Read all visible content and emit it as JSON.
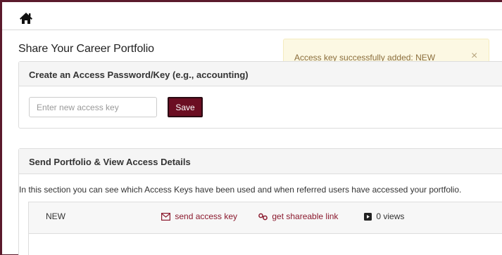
{
  "topbar": {
    "home_icon": "home-icon"
  },
  "page": {
    "title": "Share Your Career Portfolio"
  },
  "alert": {
    "message": "Access key successfully added: NEW",
    "close_label": "×",
    "background_color": "#fcf8e3",
    "text_color": "#8a6d3b"
  },
  "create_panel": {
    "title": "Create an Access Password/Key (e.g., accounting)",
    "input_placeholder": "Enter new access key",
    "input_value": "",
    "save_label": "Save",
    "save_color": "#6b0e22"
  },
  "send_panel": {
    "title": "Send Portfolio & View Access Details",
    "description": "In this section you can see which Access Keys have been used and when referred users have accessed your portfolio.",
    "keys": [
      {
        "name": "NEW",
        "send_label": "send access key",
        "send_icon": "envelope-icon",
        "share_label": "get shareable link",
        "share_icon": "link-icon",
        "views_label": "0 views",
        "views_icon": "play-square-icon"
      }
    ]
  },
  "colors": {
    "brand": "#5b1a2c",
    "link": "#8b1a2e"
  }
}
